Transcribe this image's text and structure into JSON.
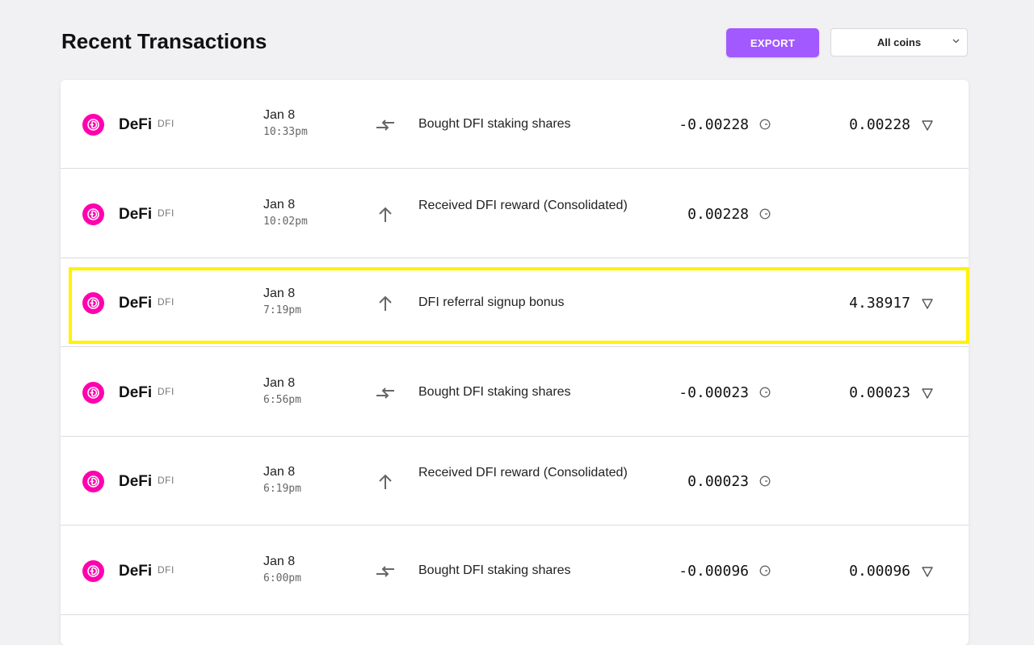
{
  "page": {
    "title": "Recent Transactions"
  },
  "toolbar": {
    "export_label": "EXPORT",
    "filter_selected": "All coins"
  },
  "colors": {
    "accent": "#a259ff",
    "coin": "#ff00af",
    "highlight": "#fff200"
  },
  "transactions": [
    {
      "coin": "DeFi",
      "ticker": "DFI",
      "date": "Jan 8",
      "time": "10:33pm",
      "type_icon": "swap-icon",
      "description": "Bought DFI staking shares",
      "amount": "-0.00228",
      "value": "0.00228"
    },
    {
      "coin": "DeFi",
      "ticker": "DFI",
      "date": "Jan 8",
      "time": "10:02pm",
      "type_icon": "arrow-up-icon",
      "description": "Received DFI reward (Consolidated)",
      "amount": "0.00228",
      "value": ""
    },
    {
      "coin": "DeFi",
      "ticker": "DFI",
      "date": "Jan 8",
      "time": "7:19pm",
      "type_icon": "arrow-up-icon",
      "description": "DFI referral signup bonus",
      "amount": "",
      "value": "4.38917"
    },
    {
      "coin": "DeFi",
      "ticker": "DFI",
      "date": "Jan 8",
      "time": "6:56pm",
      "type_icon": "swap-icon",
      "description": "Bought DFI staking shares",
      "amount": "-0.00023",
      "value": "0.00023"
    },
    {
      "coin": "DeFi",
      "ticker": "DFI",
      "date": "Jan 8",
      "time": "6:19pm",
      "type_icon": "arrow-up-icon",
      "description": "Received DFI reward (Consolidated)",
      "amount": "0.00023",
      "value": ""
    },
    {
      "coin": "DeFi",
      "ticker": "DFI",
      "date": "Jan 8",
      "time": "6:00pm",
      "type_icon": "swap-icon",
      "description": "Bought DFI staking shares",
      "amount": "-0.00096",
      "value": "0.00096"
    }
  ]
}
